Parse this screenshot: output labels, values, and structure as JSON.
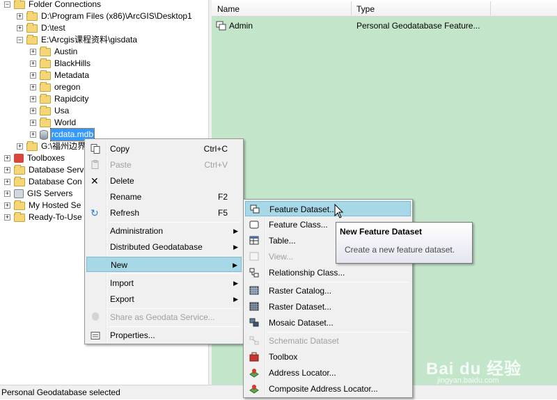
{
  "tree": {
    "items": [
      {
        "label": "Folder Connections",
        "expander": "−"
      },
      {
        "label": "D:\\Program Files (x86)\\ArcGIS\\Desktop1",
        "expander": "+"
      },
      {
        "label": "D:\\test",
        "expander": "+"
      },
      {
        "label": "E:\\Arcgis课程资料\\gisdata",
        "expander": "−"
      },
      {
        "label": "Austin",
        "expander": "+"
      },
      {
        "label": "BlackHills",
        "expander": "+"
      },
      {
        "label": "Metadata",
        "expander": "+"
      },
      {
        "label": "oregon",
        "expander": "+"
      },
      {
        "label": "Rapidcity",
        "expander": "+"
      },
      {
        "label": "Usa",
        "expander": "+"
      },
      {
        "label": "World",
        "expander": "+"
      },
      {
        "label": "rcdata.mdb",
        "expander": "+"
      },
      {
        "label": "G:\\福州边界",
        "expander": "+"
      },
      {
        "label": "Toolboxes",
        "expander": "+"
      },
      {
        "label": "Database Serv",
        "expander": "+"
      },
      {
        "label": "Database Con",
        "expander": "+"
      },
      {
        "label": "GIS Servers",
        "expander": "+"
      },
      {
        "label": "My Hosted Se",
        "expander": "+"
      },
      {
        "label": "Ready-To-Use",
        "expander": "+"
      }
    ]
  },
  "list": {
    "columns": [
      "Name",
      "Type"
    ],
    "rows": [
      {
        "name": "Admin",
        "type": "Personal Geodatabase Feature..."
      }
    ]
  },
  "status": "Personal Geodatabase selected",
  "context_menu": {
    "items": [
      {
        "label": "Copy",
        "shortcut": "Ctrl+C"
      },
      {
        "label": "Paste",
        "shortcut": "Ctrl+V"
      },
      {
        "label": "Delete"
      },
      {
        "label": "Rename",
        "shortcut": "F2"
      },
      {
        "label": "Refresh",
        "shortcut": "F5"
      },
      {
        "label": "Administration"
      },
      {
        "label": "Distributed Geodatabase"
      },
      {
        "label": "New"
      },
      {
        "label": "Import"
      },
      {
        "label": "Export"
      },
      {
        "label": "Share as Geodata Service..."
      },
      {
        "label": "Properties..."
      }
    ]
  },
  "submenu": {
    "items": [
      {
        "label": "Feature Dataset..."
      },
      {
        "label": "Feature Class..."
      },
      {
        "label": "Table..."
      },
      {
        "label": "View..."
      },
      {
        "label": "Relationship Class..."
      },
      {
        "label": "Raster Catalog..."
      },
      {
        "label": "Raster Dataset..."
      },
      {
        "label": "Mosaic Dataset..."
      },
      {
        "label": "Schematic Dataset"
      },
      {
        "label": "Toolbox"
      },
      {
        "label": "Address Locator..."
      },
      {
        "label": "Composite Address Locator..."
      }
    ]
  },
  "tooltip": {
    "title": "New Feature Dataset",
    "description": "Create a new feature dataset."
  },
  "watermark": {
    "text": "Bai du 经验",
    "sub": "jingyan.baidu.com"
  },
  "colors": {
    "list_bg": "#c3e6cb",
    "highlight": "#a6d8e8",
    "selection": "#3399ff"
  }
}
